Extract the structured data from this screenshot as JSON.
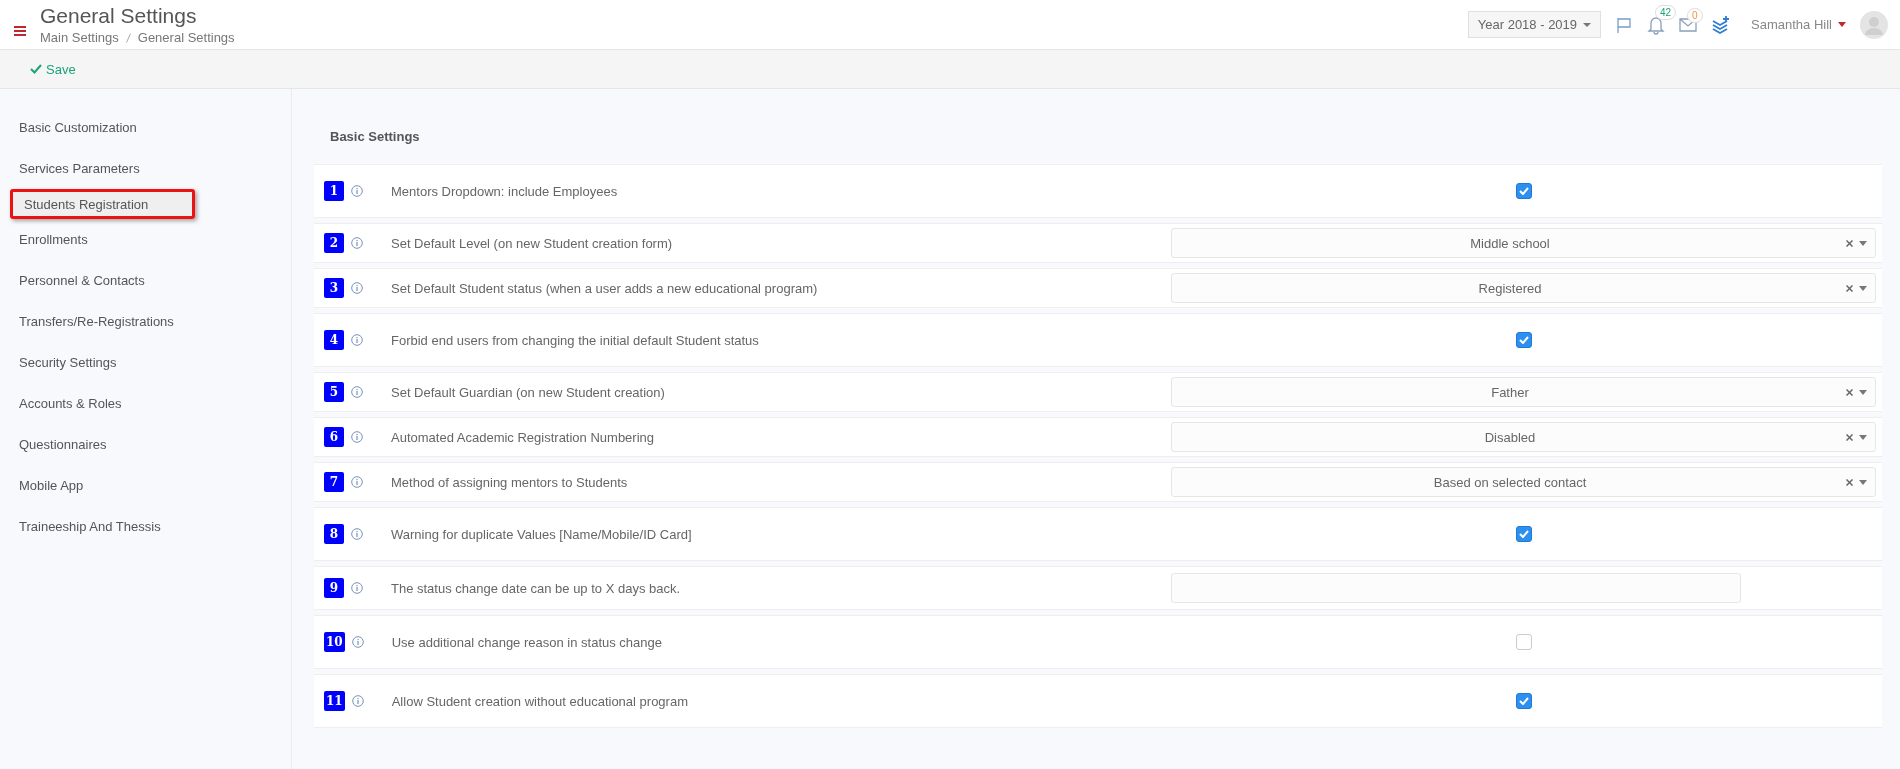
{
  "header": {
    "title": "General Settings",
    "breadcrumb": [
      "Main Settings",
      "General Settings"
    ],
    "year": "Year 2018 - 2019",
    "notifications": "42",
    "messages": "0",
    "user": "Samantha Hill"
  },
  "toolbar": {
    "save": "Save"
  },
  "sidebar": {
    "items": [
      {
        "label": "Basic Customization",
        "selected": false,
        "highlighted": false
      },
      {
        "label": "Services Parameters",
        "selected": false,
        "highlighted": false
      },
      {
        "label": "Students Registration",
        "selected": true,
        "highlighted": true
      },
      {
        "label": "Enrollments",
        "selected": false,
        "highlighted": false
      },
      {
        "label": "Personnel & Contacts",
        "selected": false,
        "highlighted": false
      },
      {
        "label": "Transfers/Re-Registrations",
        "selected": false,
        "highlighted": false
      },
      {
        "label": "Security Settings",
        "selected": false,
        "highlighted": false
      },
      {
        "label": "Accounts & Roles",
        "selected": false,
        "highlighted": false
      },
      {
        "label": "Questionnaires",
        "selected": false,
        "highlighted": false
      },
      {
        "label": "Mobile App",
        "selected": false,
        "highlighted": false
      },
      {
        "label": "Traineeship And Thessis",
        "selected": false,
        "highlighted": false
      }
    ]
  },
  "section_title": "Basic Settings",
  "settings": [
    {
      "number": "1",
      "label": "Mentors Dropdown: include Employees",
      "kind": "checkbox",
      "checked": true
    },
    {
      "number": "2",
      "label": "Set Default Level (on new Student creation form)",
      "kind": "select",
      "value": "Middle school"
    },
    {
      "number": "3",
      "label": "Set Default Student status (when a user adds a new educational program)",
      "kind": "select",
      "value": "Registered"
    },
    {
      "number": "4",
      "label": "Forbid end users from changing the initial default Student status",
      "kind": "checkbox",
      "checked": true
    },
    {
      "number": "5",
      "label": "Set Default Guardian (on new Student creation)",
      "kind": "select",
      "value": "Father"
    },
    {
      "number": "6",
      "label": "Automated Academic Registration Numbering",
      "kind": "select",
      "value": "Disabled"
    },
    {
      "number": "7",
      "label": "Method of assigning mentors to Students",
      "kind": "select",
      "value": "Based on selected contact"
    },
    {
      "number": "8",
      "label": "Warning for duplicate Values [Name/Mobile/ID Card]",
      "kind": "checkbox",
      "checked": true
    },
    {
      "number": "9",
      "label": "The status change date can be up to X days back.",
      "kind": "input"
    },
    {
      "number": "10",
      "label": "Use additional change reason in status change",
      "kind": "checkbox",
      "checked": false
    },
    {
      "number": "11",
      "label": "Allow Student creation without educational program",
      "kind": "checkbox",
      "checked": true
    }
  ]
}
